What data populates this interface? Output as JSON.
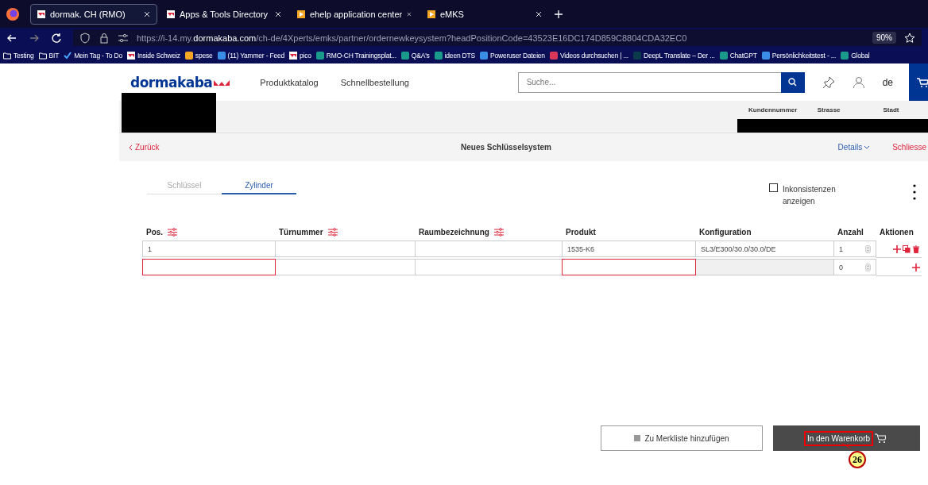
{
  "browser": {
    "tabs": [
      {
        "title": "dormak. CH (RMO)",
        "kind": "brand",
        "selected": true
      },
      {
        "title": "Apps & Tools Directory",
        "kind": "brand",
        "selected": false
      },
      {
        "title": "ehelp application center",
        "kind": "play",
        "selected": false
      },
      {
        "title": "eMKS",
        "kind": "play",
        "selected": false
      }
    ],
    "url": {
      "prefix": "https://i-14.my.",
      "domain": "dormakaba.com",
      "path": "/ch-de/4Xperts/emks/partner/ordernewkeysystem?headPositionCode=43523E16DC174D859C8804CDA32EC0"
    },
    "zoom": "90%",
    "bookmarks": [
      {
        "label": "Testing",
        "kind": "folder"
      },
      {
        "label": "BIT",
        "kind": "folder"
      },
      {
        "label": "Mein Tag - To Do",
        "kind": "check"
      },
      {
        "label": "Inside Schweiz",
        "kind": "brand"
      },
      {
        "label": "spese",
        "kind": "orange"
      },
      {
        "label": "(11) Yammer - Feed",
        "kind": "blue"
      },
      {
        "label": "pico",
        "kind": "brand"
      },
      {
        "label": "RMO-CH Trainingsplat...",
        "kind": "teal"
      },
      {
        "label": "Q&A's",
        "kind": "teal"
      },
      {
        "label": "ideen DTS",
        "kind": "teal"
      },
      {
        "label": "Poweruser Dateien",
        "kind": "blue"
      },
      {
        "label": "Videos durchsuchen | ...",
        "kind": "red"
      },
      {
        "label": "DeepL Translate – Der ...",
        "kind": "dark"
      },
      {
        "label": "ChatGPT",
        "kind": "teal"
      },
      {
        "label": "Persönlichkeitstest - ...",
        "kind": "blue"
      },
      {
        "label": "Global",
        "kind": "teal"
      }
    ]
  },
  "header": {
    "logo": "dormakaba",
    "nav": [
      "Produktkatalog",
      "Schnellbestellung"
    ],
    "search": {
      "placeholder": "Suche..."
    },
    "language": "de"
  },
  "customer": {
    "columns": [
      "Kundennummer",
      "Strasse",
      "Stadt"
    ]
  },
  "subnav": {
    "back": "Zurück",
    "title": "Neues Schlüsselsystem",
    "details": "Details",
    "close": "Schliesse"
  },
  "tabs": [
    {
      "label": "Schlüssel",
      "selected": false
    },
    {
      "label": "Zylinder",
      "selected": true
    }
  ],
  "inconsistencies": {
    "label": "Inkonsistenzen anzeigen",
    "checked": false
  },
  "table": {
    "columns": [
      {
        "label": "Pos.",
        "filter": true
      },
      {
        "label": "Türnummer",
        "filter": true
      },
      {
        "label": "Raumbezeichnung",
        "filter": true
      },
      {
        "label": "Produkt",
        "filter": false
      },
      {
        "label": "Konfiguration",
        "filter": false
      },
      {
        "label": "Anzahl",
        "filter": false
      },
      {
        "label": "Aktionen",
        "filter": false
      }
    ],
    "rows": [
      {
        "cells": [
          {
            "value": "1",
            "invalid": false,
            "disabled": false
          },
          {
            "invalid": false,
            "disabled": false
          },
          {
            "invalid": false,
            "disabled": false
          },
          {
            "value": "1535-K6",
            "invalid": false,
            "disabled": false
          },
          {
            "value": "SL3/E300/30.0/30.0/DE",
            "invalid": false,
            "disabled": false
          }
        ],
        "quantity": "1",
        "actions": [
          {
            "kind": "add"
          },
          {
            "kind": "copy"
          },
          {
            "kind": "delete"
          }
        ]
      },
      {
        "cells": [
          {
            "invalid": true,
            "disabled": false
          },
          {
            "invalid": false,
            "disabled": false
          },
          {
            "invalid": false,
            "disabled": false
          },
          {
            "invalid": true,
            "disabled": false
          },
          {
            "invalid": false,
            "disabled": true
          }
        ],
        "quantity": "0",
        "actions": [
          {
            "kind": "add"
          }
        ]
      }
    ]
  },
  "buttons": {
    "wishlist": "Zu Merkliste hinzufügen",
    "cart": "In den Warenkorb"
  },
  "annotation": {
    "label": "26"
  }
}
